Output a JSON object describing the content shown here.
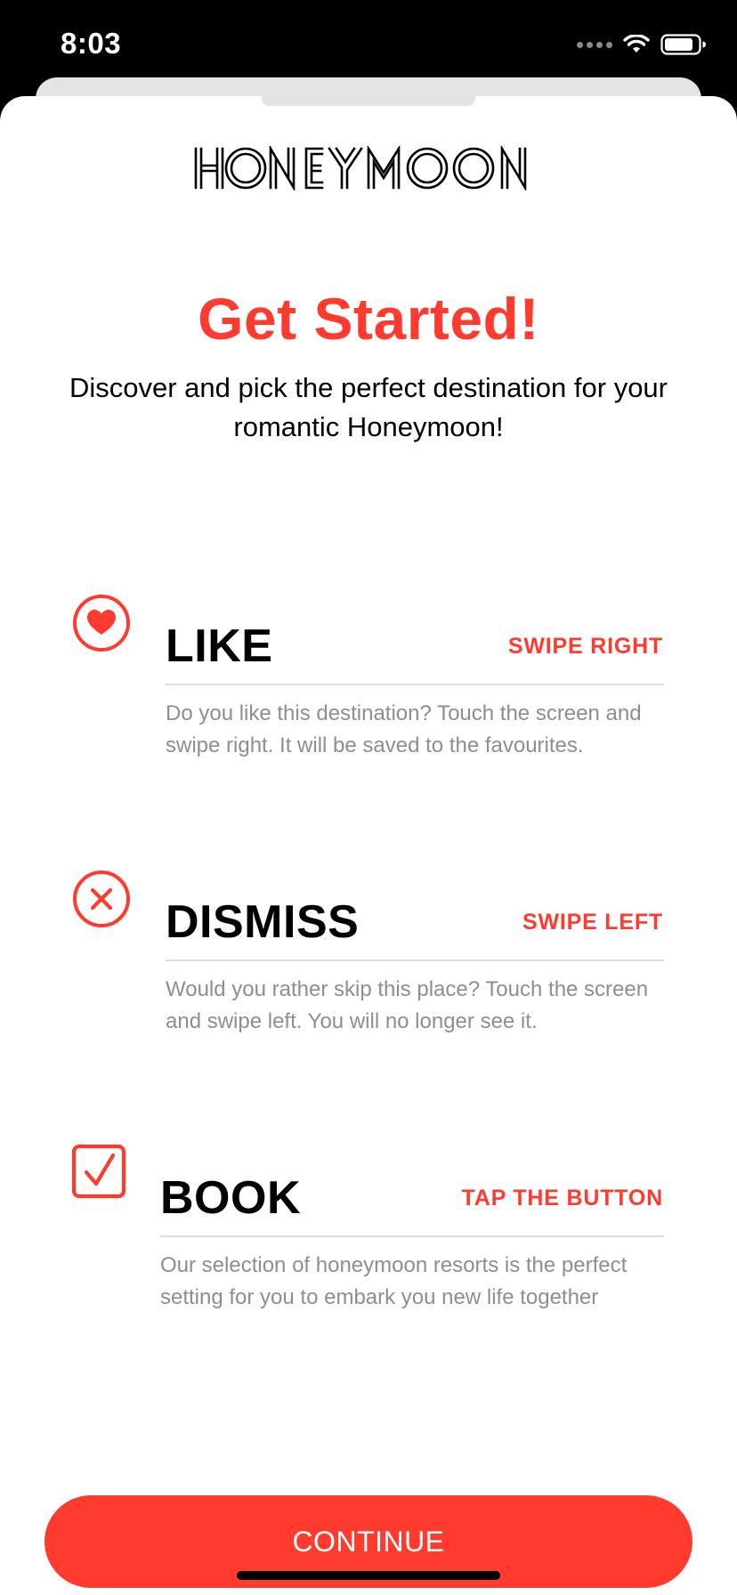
{
  "status_bar": {
    "time": "8:03"
  },
  "app": {
    "logo_text": "HONEYMOON",
    "title": "Get Started!",
    "subtitle": "Discover and pick the perfect destination for your romantic Honeymoon!"
  },
  "features": [
    {
      "title": "LIKE",
      "action": "SWIPE RIGHT",
      "description": "Do you like this destination? Touch the screen and swipe right. It will be saved to the favourites.",
      "icon": "heart-circle-icon"
    },
    {
      "title": "DISMISS",
      "action": "SWIPE LEFT",
      "description": "Would you rather skip this place? Touch the screen and swipe left. You will no longer see it.",
      "icon": "x-circle-icon"
    },
    {
      "title": "BOOK",
      "action": "TAP THE BUTTON",
      "description": "Our selection of honeymoon resorts is the perfect setting for you to embark you new life together",
      "icon": "checkmark-square-icon"
    }
  ],
  "continue_button": {
    "label": "CONTINUE"
  },
  "colors": {
    "accent": "#ff3b30",
    "text": "#000000",
    "secondary_text": "#8e8e8e",
    "background": "#ffffff"
  }
}
